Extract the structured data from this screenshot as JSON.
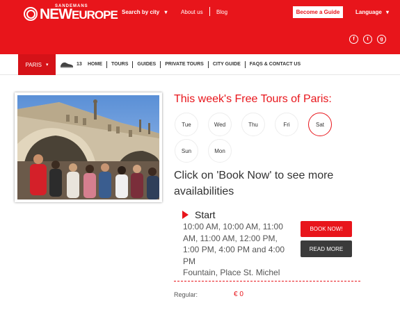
{
  "brand": {
    "small": "SANDEMANS",
    "new": "NEW",
    "europe": "EUROPE"
  },
  "nav": {
    "search_by_city": "Search by city",
    "about_us": "About us",
    "blog": "Blog",
    "become_guide": "Become a Guide",
    "language": "Language"
  },
  "social": [
    "f",
    "t",
    "g"
  ],
  "subnav": {
    "city": "PARIS",
    "count": "13",
    "links": [
      "HOME",
      "TOURS",
      "GUIDES",
      "PRIVATE TOURS",
      "CITY GUIDE",
      "FAQS & CONTACT US"
    ]
  },
  "tour": {
    "headline": "This week's Free Tours of Paris:",
    "days": [
      "Tue",
      "Wed",
      "Thu",
      "Fri",
      "Sat",
      "Sun",
      "Mon"
    ],
    "selected_day": "Sat",
    "cta": "Click on 'Book Now' to see more availabilities",
    "start_label": "Start",
    "times": "10:00 AM, 10:00 AM, 11:00 AM, 11:00 AM, 12:00 PM, 1:00 PM, 4:00 PM and 4:00 PM",
    "location": "Fountain, Place St. Michel",
    "book_now": "BOOK NOW!",
    "read_more": "READ MORE",
    "regular_label": "Regular:",
    "price": "€ 0"
  },
  "colors": {
    "brand_red": "#e8151b",
    "dark_button": "#3b3b3b"
  },
  "icons": [
    "logo-icon",
    "chevron-down-icon",
    "walking-shoe-icon",
    "facebook-icon",
    "twitter-icon",
    "google-plus-icon",
    "play-arrow-icon"
  ]
}
